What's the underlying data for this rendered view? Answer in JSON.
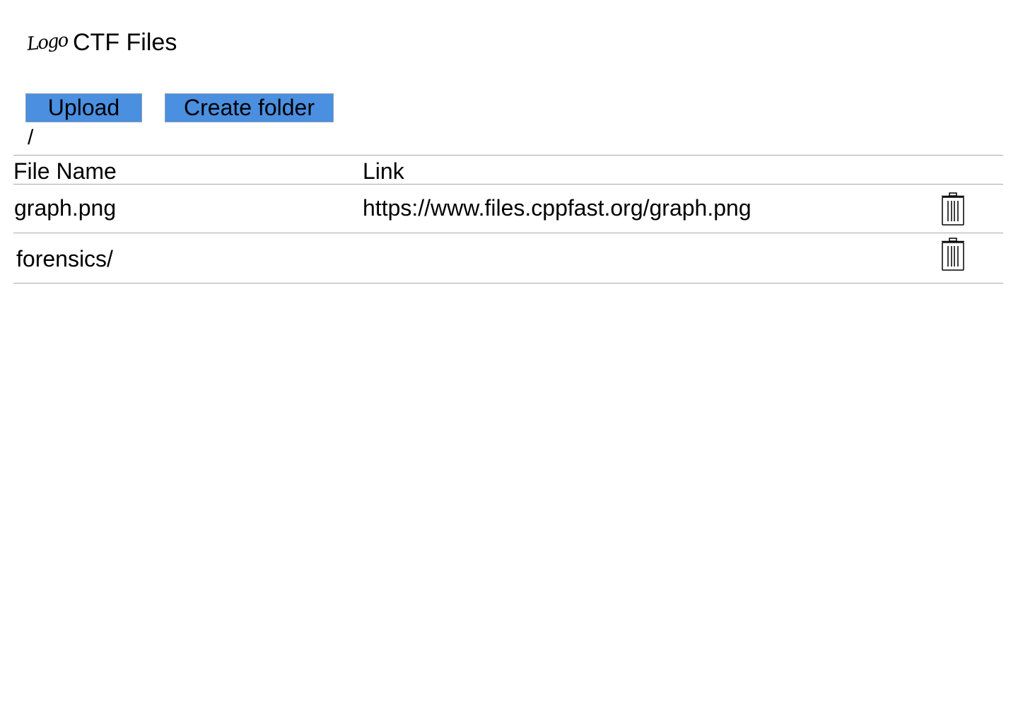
{
  "header": {
    "logo_text": "Logo",
    "title": "CTF Files"
  },
  "toolbar": {
    "upload_label": "Upload",
    "create_folder_label": "Create folder"
  },
  "current_path": "/",
  "table": {
    "columns": [
      "File Name",
      "Link"
    ],
    "rows": [
      {
        "name": "graph.png",
        "link": "https://www.files.cppfast.org/graph.png",
        "action_icon": "trash-icon"
      },
      {
        "name": "forensics/",
        "link": "",
        "action_icon": "trash-icon"
      }
    ]
  },
  "colors": {
    "button_bg": "#4a8fe0",
    "divider": "#a9a9a9",
    "logo_accent": "#1fb6c9"
  }
}
